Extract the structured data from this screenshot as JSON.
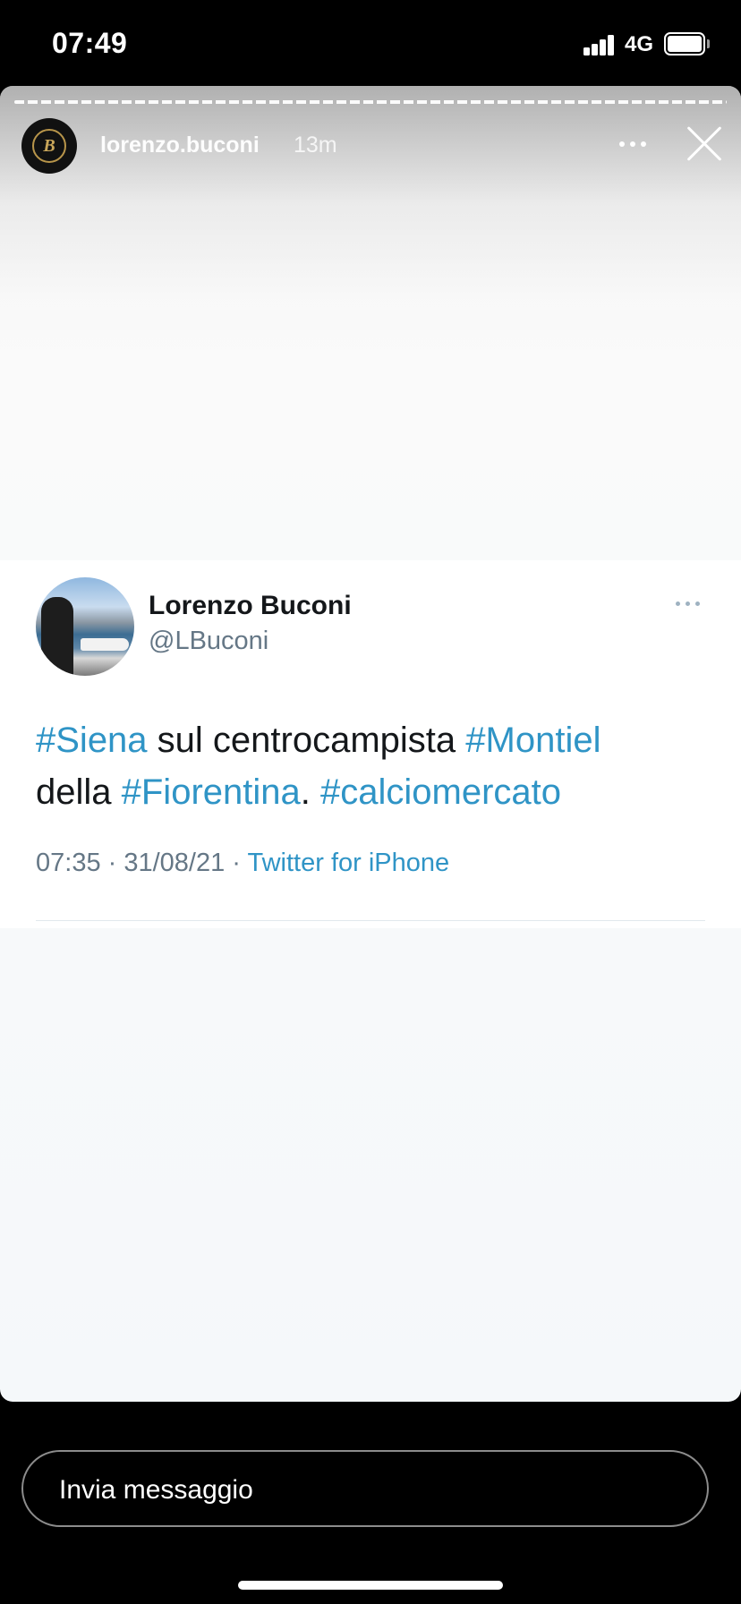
{
  "status_bar": {
    "time": "07:49",
    "network": "4G",
    "icons": [
      "signal-bars-icon",
      "battery-icon"
    ]
  },
  "story": {
    "username": "lorenzo.buconi",
    "time_ago": "13m",
    "avatar_monogram": "B",
    "icons": [
      "more-options-icon",
      "close-icon"
    ]
  },
  "tweet": {
    "display_name": "Lorenzo Buconi",
    "handle": "@LBuconi",
    "text": {
      "hashtag_1": "#Siena",
      "plain_1": " sul centrocampista ",
      "hashtag_2": "#Montiel",
      "plain_2": "della ",
      "hashtag_3": "#Fiorentina",
      "plain_3": ". ",
      "hashtag_4": "#calciomercato"
    },
    "meta": {
      "time": "07:35",
      "separator_1": " · ",
      "date": "31/08/21",
      "separator_2": " · ",
      "source": "Twitter for iPhone"
    },
    "accent_color": "#2f94c6"
  },
  "reply": {
    "placeholder": "Invia messaggio"
  }
}
